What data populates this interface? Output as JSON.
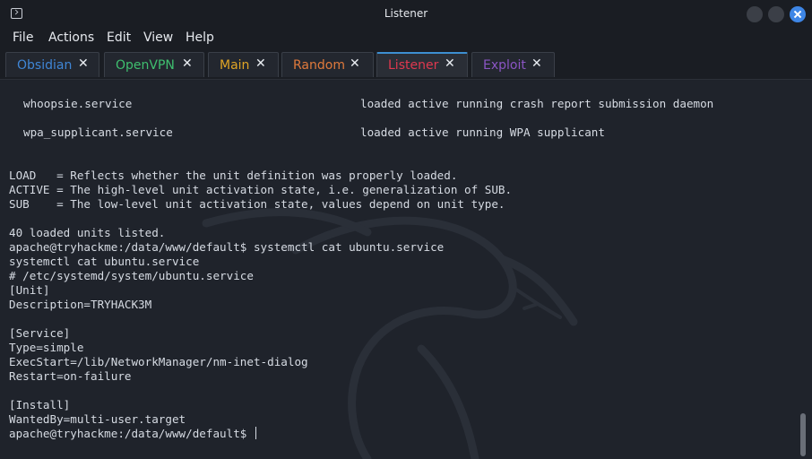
{
  "window": {
    "title": "Listener"
  },
  "menu": [
    "File",
    "Actions",
    "Edit",
    "View",
    "Help"
  ],
  "tabs": [
    {
      "label": "Obsidian",
      "color": "#3f86d6"
    },
    {
      "label": "OpenVPN",
      "color": "#3fbf6f"
    },
    {
      "label": "Main",
      "color": "#e0a526"
    },
    {
      "label": "Random",
      "color": "#e07a3c"
    },
    {
      "label": "Listener",
      "color": "#e0384f",
      "active": true
    },
    {
      "label": "Exploit",
      "color": "#8b55c4"
    }
  ],
  "close_symbol": "✕",
  "terminal": {
    "services": [
      {
        "unit": "whoopsie.service",
        "status": "loaded active running crash report submission daemon"
      },
      {
        "unit": "wpa_supplicant.service",
        "status": "loaded active running WPA supplicant"
      }
    ],
    "lines": [
      "LOAD   = Reflects whether the unit definition was properly loaded.",
      "ACTIVE = The high-level unit activation state, i.e. generalization of SUB.",
      "SUB    = The low-level unit activation state, values depend on unit type.",
      "",
      "40 loaded units listed.",
      "apache@tryhackme:/data/www/default$ systemctl cat ubuntu.service",
      "systemctl cat ubuntu.service",
      "# /etc/systemd/system/ubuntu.service",
      "[Unit]",
      "Description=TRYHACK3M",
      "",
      "[Service]",
      "Type=simple",
      "ExecStart=/lib/NetworkManager/nm-inet-dialog",
      "Restart=on-failure",
      "",
      "[Install]",
      "WantedBy=multi-user.target"
    ],
    "prompt": "apache@tryhackme:/data/www/default$ "
  }
}
